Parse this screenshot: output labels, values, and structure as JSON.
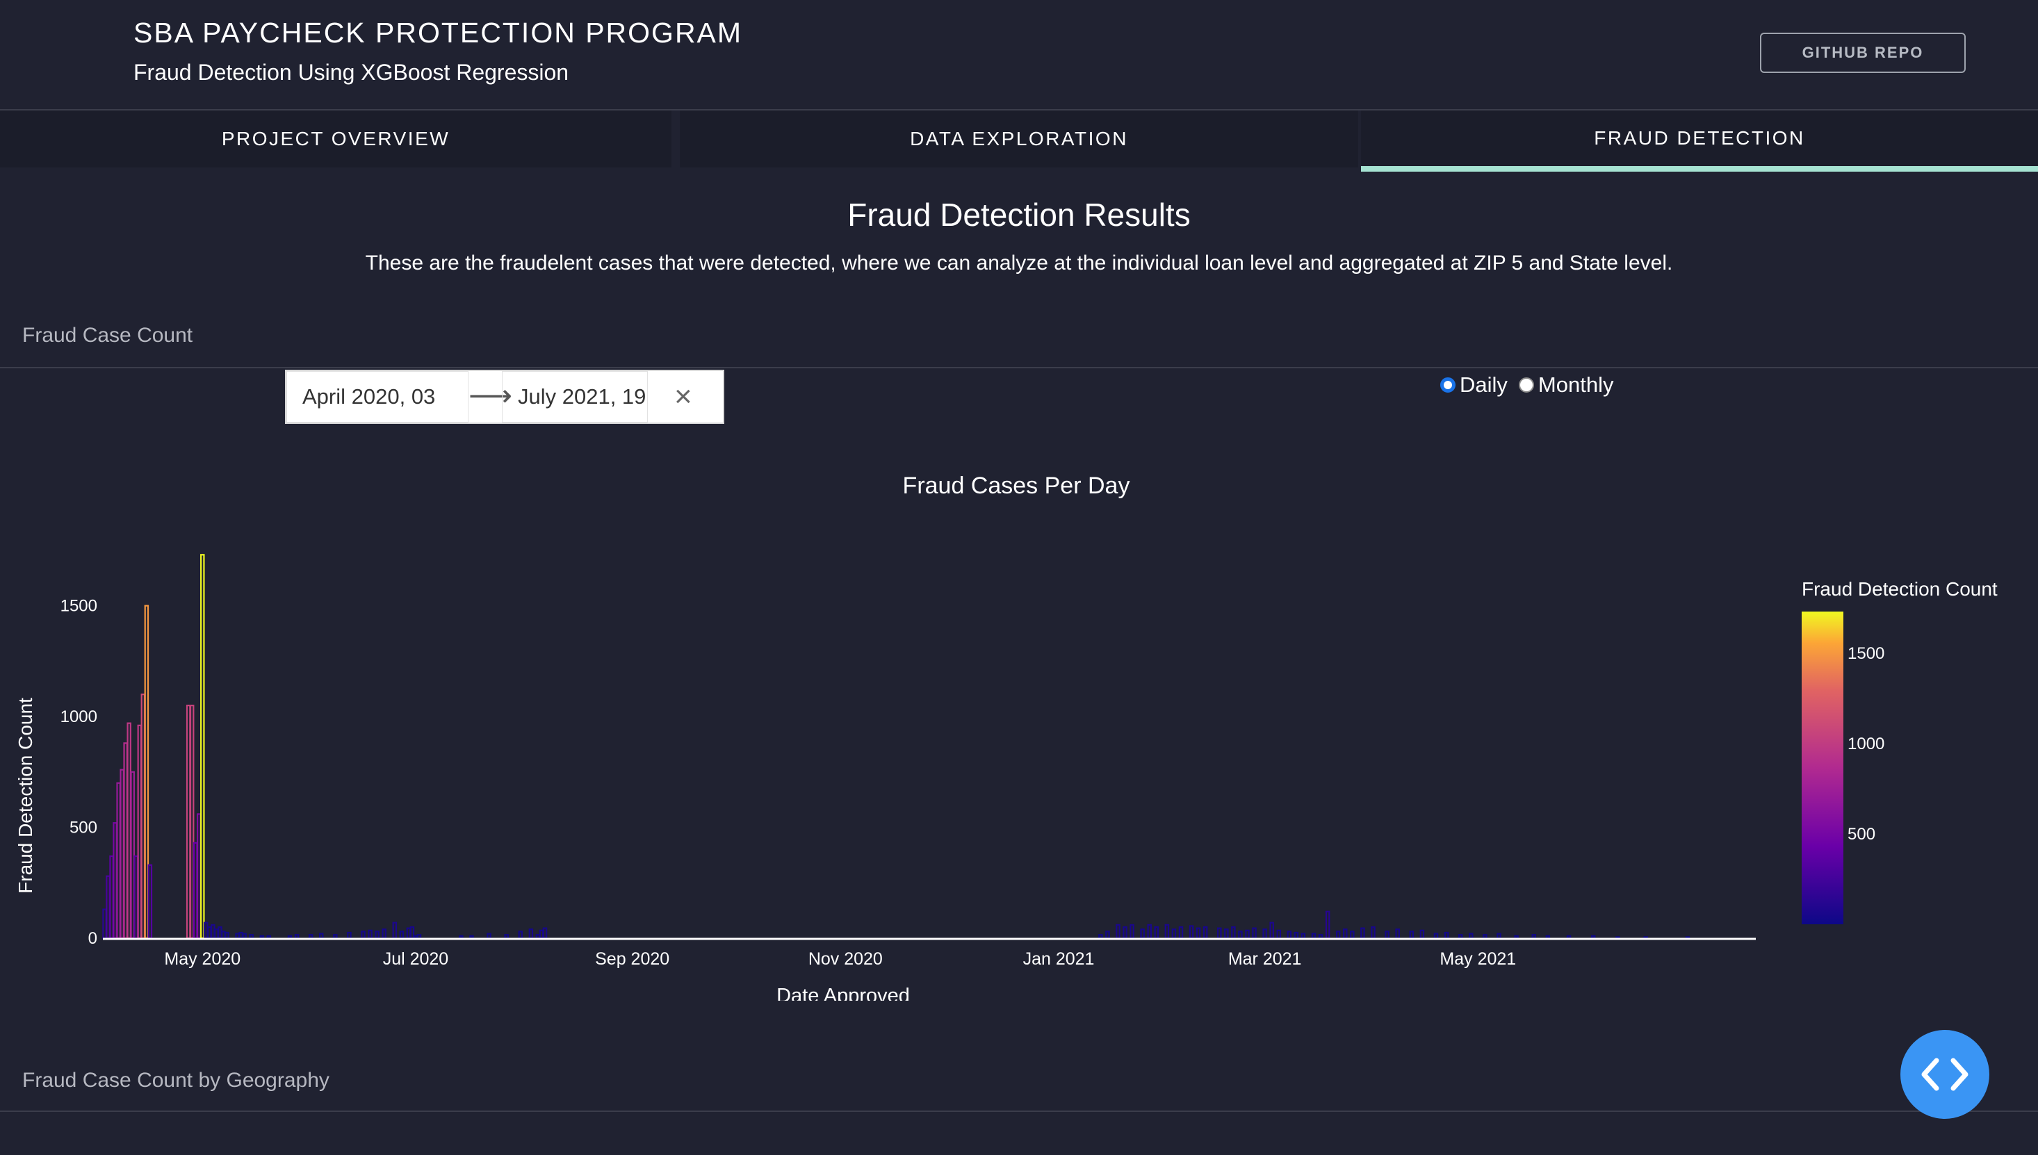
{
  "header": {
    "title": "SBA PAYCHECK PROTECTION PROGRAM",
    "subtitle": "Fraud Detection Using XGBoost Regression",
    "repo_button": "GITHUB REPO"
  },
  "tabs": [
    {
      "label": "PROJECT OVERVIEW",
      "active": false
    },
    {
      "label": "DATA EXPLORATION",
      "active": false
    },
    {
      "label": "FRAUD DETECTION",
      "active": true
    }
  ],
  "results": {
    "title": "Fraud Detection Results",
    "description": "These are the fraudelent cases that were detected, where we can analyze at the individual loan level and aggregated at ZIP 5 and State level."
  },
  "panels": {
    "count_label": "Fraud Case Count",
    "geo_label": "Fraud Case Count by Geography"
  },
  "date_range": {
    "start": "April 2020, 03",
    "end": "July 2021, 19",
    "arrow_icon": "arrow-right-icon",
    "clear_icon": "close-icon"
  },
  "granularity": {
    "options": [
      "Daily",
      "Monthly"
    ],
    "selected": "Daily"
  },
  "fab": {
    "icon": "code-icon",
    "color": "#3a95f4"
  },
  "colors": {
    "background": "#202231",
    "tab_bg": "#1b1d2a",
    "active_tab_underline": "#a6e3d2"
  },
  "chart_data": {
    "type": "bar",
    "title": "Fraud Cases Per Day",
    "xlabel": "Date Approved",
    "ylabel": "Fraud Detection Count",
    "x_ticks": [
      "May 2020",
      "Jul 2020",
      "Sep 2020",
      "Nov 2020",
      "Jan 2021",
      "Mar 2021",
      "May 2021"
    ],
    "y_ticks": [
      0,
      500,
      1000,
      1500
    ],
    "ylim": [
      0,
      1850
    ],
    "colorscale": "plasma",
    "colorbar": {
      "title": "Fraud Detection Count",
      "ticks": [
        500,
        1000,
        1500
      ],
      "range": [
        0,
        1730
      ]
    },
    "x_range": [
      "2020-04-03",
      "2021-07-19"
    ],
    "series": [
      {
        "x": [
          "2020-04-03",
          "2020-04-04",
          "2020-04-05",
          "2020-04-06",
          "2020-04-07",
          "2020-04-08",
          "2020-04-09",
          "2020-04-10",
          "2020-04-11",
          "2020-04-12",
          "2020-04-13",
          "2020-04-14",
          "2020-04-15",
          "2020-04-16",
          "2020-04-27",
          "2020-04-28",
          "2020-04-29",
          "2020-04-30",
          "2020-05-01",
          "2020-05-02",
          "2020-05-03",
          "2020-05-04",
          "2020-05-05",
          "2020-05-06",
          "2020-05-07",
          "2020-05-08",
          "2020-05-11",
          "2020-05-12",
          "2020-05-13",
          "2020-05-15",
          "2020-05-18",
          "2020-05-20",
          "2020-05-26",
          "2020-05-28",
          "2020-06-01",
          "2020-06-04",
          "2020-06-08",
          "2020-06-12",
          "2020-06-16",
          "2020-06-18",
          "2020-06-20",
          "2020-06-22",
          "2020-06-25",
          "2020-06-27",
          "2020-06-29",
          "2020-06-30",
          "2020-07-01",
          "2020-07-02",
          "2020-07-14",
          "2020-07-17",
          "2020-07-22",
          "2020-07-27",
          "2020-07-31",
          "2020-08-03",
          "2020-08-05",
          "2020-08-06",
          "2020-08-07",
          "2021-01-13",
          "2021-01-15",
          "2021-01-18",
          "2021-01-20",
          "2021-01-22",
          "2021-01-25",
          "2021-01-27",
          "2021-01-29",
          "2021-02-01",
          "2021-02-03",
          "2021-02-05",
          "2021-02-08",
          "2021-02-10",
          "2021-02-12",
          "2021-02-16",
          "2021-02-18",
          "2021-02-20",
          "2021-02-22",
          "2021-02-24",
          "2021-02-26",
          "2021-03-01",
          "2021-03-03",
          "2021-03-05",
          "2021-03-08",
          "2021-03-10",
          "2021-03-12",
          "2021-03-15",
          "2021-03-17",
          "2021-03-19",
          "2021-03-22",
          "2021-03-24",
          "2021-03-26",
          "2021-03-29",
          "2021-04-01",
          "2021-04-05",
          "2021-04-08",
          "2021-04-12",
          "2021-04-15",
          "2021-04-19",
          "2021-04-22",
          "2021-04-26",
          "2021-04-29",
          "2021-05-03",
          "2021-05-07",
          "2021-05-12",
          "2021-05-17",
          "2021-05-21",
          "2021-05-27",
          "2021-06-03",
          "2021-06-10",
          "2021-06-18",
          "2021-06-30"
        ],
        "y": [
          130,
          280,
          370,
          520,
          700,
          760,
          880,
          970,
          750,
          370,
          960,
          1100,
          1500,
          330,
          1050,
          1050,
          430,
          560,
          1730,
          70,
          50,
          60,
          40,
          50,
          30,
          25,
          20,
          25,
          20,
          15,
          10,
          10,
          10,
          15,
          15,
          20,
          15,
          25,
          30,
          35,
          30,
          40,
          70,
          30,
          45,
          50,
          10,
          15,
          10,
          10,
          20,
          15,
          30,
          40,
          15,
          35,
          45,
          15,
          30,
          60,
          50,
          60,
          40,
          60,
          50,
          60,
          40,
          50,
          55,
          45,
          50,
          45,
          40,
          50,
          30,
          35,
          45,
          40,
          70,
          35,
          30,
          25,
          20,
          20,
          15,
          120,
          30,
          40,
          30,
          45,
          50,
          30,
          40,
          30,
          35,
          20,
          25,
          15,
          20,
          15,
          20,
          10,
          15,
          10,
          10,
          10,
          5,
          5,
          5
        ]
      }
    ]
  }
}
